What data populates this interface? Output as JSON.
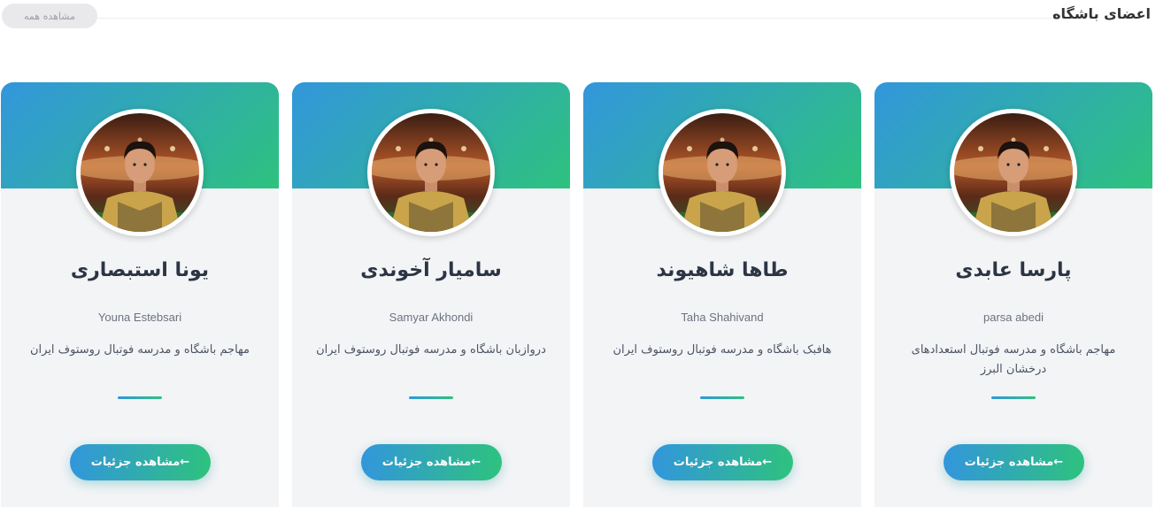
{
  "section": {
    "title": "اعضای باشگاه",
    "view_all": "مشاهده همه"
  },
  "colors": {
    "accent_start": "#3296dc",
    "accent_end": "#2ec27e",
    "name_text": "#2b3544",
    "card_bg": "#f3f4f6"
  },
  "members": [
    {
      "name": "پارسا عابدی",
      "latin_name": "parsa abedi",
      "role": "مهاجم باشگاه و مدرسه فوتبال استعدادهای درخشان البرز",
      "button": "مشاهده جزئیات←",
      "avatar_icon": "player-photo"
    },
    {
      "name": "طاها شاهیوند",
      "latin_name": "Taha Shahivand",
      "role": "هافبک باشگاه و مدرسه فوتبال روستوف ایران",
      "button": "مشاهده جزئیات←",
      "avatar_icon": "player-photo"
    },
    {
      "name": "سامیار آخوندی",
      "latin_name": "Samyar Akhondi",
      "role": "دروازبان باشگاه و مدرسه فوتبال روستوف ایران",
      "button": "مشاهده جزئیات←",
      "avatar_icon": "player-photo"
    },
    {
      "name": "یونا استبصاری",
      "latin_name": "Youna Estebsari",
      "role": "مهاجم باشگاه و مدرسه فوتبال روستوف ایران",
      "button": "مشاهده جزئیات←",
      "avatar_icon": "player-photo"
    }
  ]
}
